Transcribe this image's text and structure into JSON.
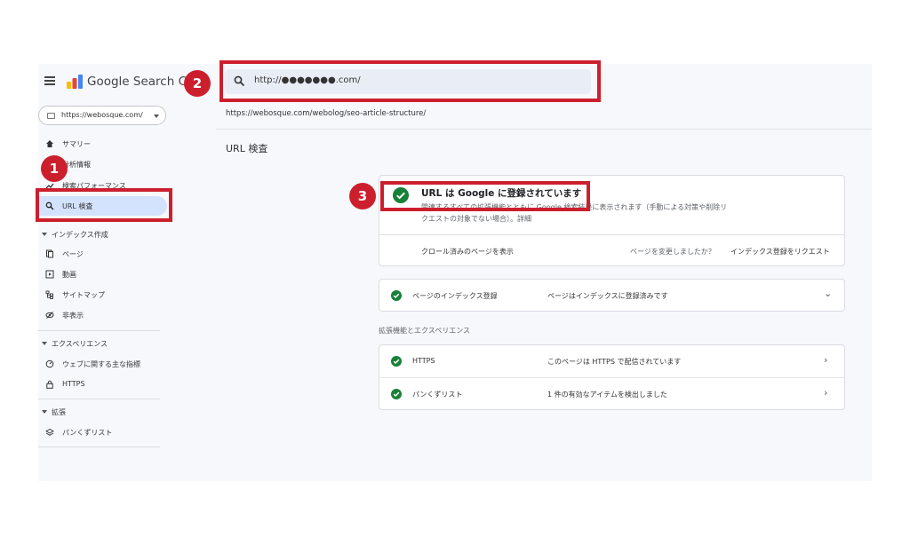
{
  "header": {
    "brand": "Google Search Console",
    "search_value": "http://●●●●●●●.com/"
  },
  "property": {
    "label": "https://webosque.com/"
  },
  "inspected_url": "https://webosque.com/webolog/seo-article-structure/",
  "page_title": "URL 検査",
  "sidebar": {
    "items": [
      {
        "label": "サマリー"
      },
      {
        "label": "分析情報"
      },
      {
        "label": "検索パフォーマンス"
      },
      {
        "label": "URL 検査"
      }
    ],
    "index_section": {
      "title": "インデックス作成",
      "items": [
        {
          "label": "ページ"
        },
        {
          "label": "動画"
        },
        {
          "label": "サイトマップ"
        },
        {
          "label": "非表示"
        }
      ]
    },
    "experience_section": {
      "title": "エクスペリエンス",
      "items": [
        {
          "label": "ウェブに関する主な指標"
        },
        {
          "label": "HTTPS"
        }
      ]
    },
    "enhancement_section": {
      "title": "拡張",
      "items": [
        {
          "label": "パンくずリスト"
        }
      ]
    }
  },
  "status_card": {
    "title": "URL は Google に登録されています",
    "description": "関連するすべての拡張機能とともに Google 検索結果に表示されます（手動による対策や削除リクエストの対象でない場合）。詳細",
    "crawl_link": "クロール済みのページを表示",
    "changed_question": "ページを変更しましたか？",
    "request_button": "インデックス登録をリクエスト"
  },
  "index_card": {
    "label": "ページのインデックス登録",
    "value": "ページはインデックスに登録済みです"
  },
  "enhancements": {
    "heading": "拡張機能とエクスペリエンス",
    "rows": [
      {
        "label": "HTTPS",
        "value": "このページは HTTPS で配信されています"
      },
      {
        "label": "パンくずリスト",
        "value": "1 件の有効なアイテムを検出しました"
      }
    ]
  },
  "annotations": {
    "badge1": "1",
    "badge2": "2",
    "badge3": "3"
  },
  "colors": {
    "annotation_red": "#cc1f2d",
    "success_green": "#188038",
    "active_nav": "#d3e3fd"
  }
}
